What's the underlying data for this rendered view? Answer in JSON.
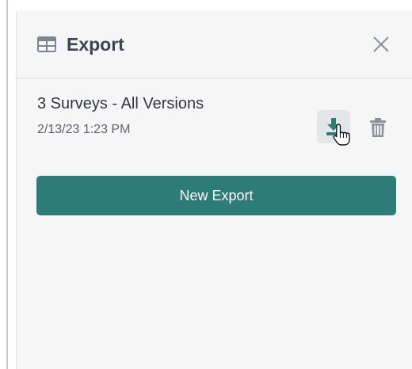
{
  "panel": {
    "title": "Export",
    "header_icon": "table-icon",
    "close_icon": "close-icon"
  },
  "export_item": {
    "title": "3 Surveys - All Versions",
    "date": "2/13/23 1:23 PM",
    "download_icon": "download-icon",
    "delete_icon": "trash-icon"
  },
  "actions": {
    "new_export_label": "New Export"
  },
  "colors": {
    "accent": "#2e7c78",
    "panel_bg": "#f6f6f7",
    "title_text": "#3d4450",
    "icon_gray": "#8a919b"
  }
}
